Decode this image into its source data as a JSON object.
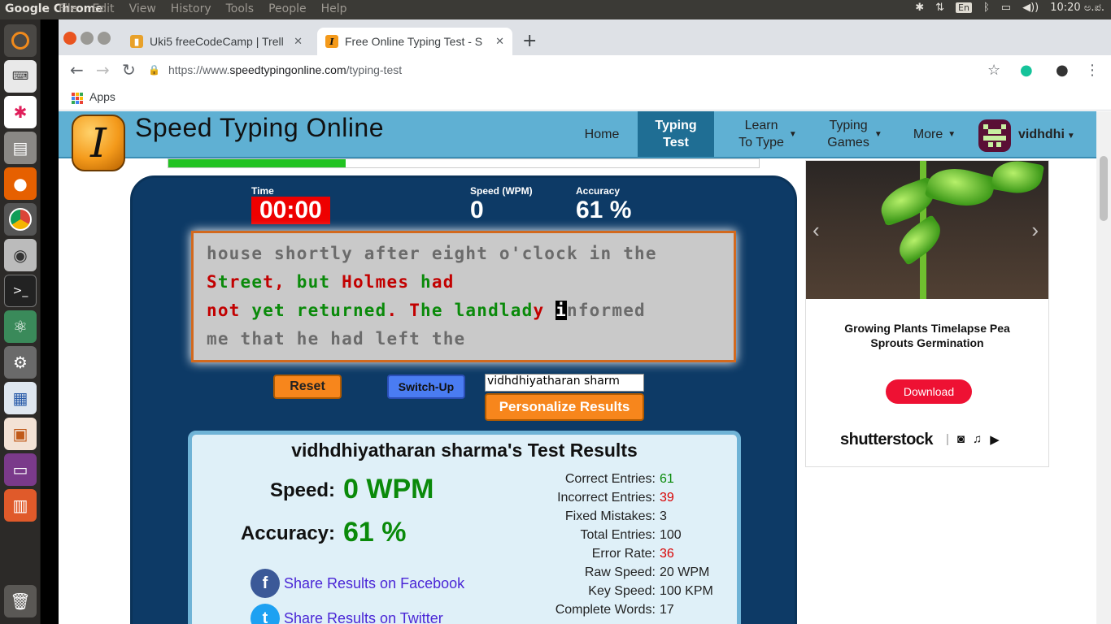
{
  "os": {
    "app_name": "Google Chrome",
    "menus": [
      "File",
      "Edit",
      "View",
      "History",
      "Tools",
      "People",
      "Help"
    ],
    "lang": "En",
    "clock": "10:20 ಅ.ಪ."
  },
  "browser": {
    "tabs": [
      {
        "title": "Uki5 freeCodeCamp | Trell",
        "favicon": "trello-icon"
      },
      {
        "title": "Free Online Typing Test - S",
        "favicon": "speedtyping-icon"
      }
    ],
    "url_scheme": "https://www.",
    "url_host": "speedtypingonline.com",
    "url_path": "/typing-test",
    "bookmark_apps": "Apps"
  },
  "site": {
    "title": "Speed Typing Online",
    "nav": [
      {
        "label1": "Home",
        "label2": ""
      },
      {
        "label1": "Typing",
        "label2": "Test"
      },
      {
        "label1": "Learn",
        "label2": "To Type"
      },
      {
        "label1": "Typing",
        "label2": "Games"
      },
      {
        "label1": "More",
        "label2": ""
      }
    ],
    "user_name": "vidhdhi",
    "progress": 0.3
  },
  "test": {
    "time_label": "Time",
    "time_value": "00:00",
    "speed_label": "Speed (WPM)",
    "speed_value": "0",
    "accuracy_label": "Accuracy",
    "accuracy_value": "61 %",
    "reset_label": "Reset",
    "switch_label": "Switch-Up",
    "name_input_value": "vidhdhiyatharan sharm",
    "personalize_label": "Personalize Results"
  },
  "results": {
    "title": "vidhdhiyatharan sharma's Test Results",
    "speed_label": "Speed:",
    "speed_value": "0 WPM",
    "accuracy_label": "Accuracy:",
    "accuracy_value": "61 %",
    "share_facebook": "Share Results on Facebook",
    "share_twitter": "Share Results on Twitter",
    "stats": [
      {
        "key": "Correct Entries:",
        "value": "61",
        "tone": "green"
      },
      {
        "key": "Incorrect Entries:",
        "value": "39",
        "tone": "red"
      },
      {
        "key": "Fixed Mistakes:",
        "value": "3",
        "tone": ""
      },
      {
        "key": "Total Entries:",
        "value": "100",
        "tone": ""
      },
      {
        "key": "Error Rate:",
        "value": "36",
        "tone": "red"
      },
      {
        "key": "Raw Speed:",
        "value": "20 WPM",
        "tone": ""
      },
      {
        "key": "Key Speed:",
        "value": "100 KPM",
        "tone": ""
      },
      {
        "key": "Complete Words:",
        "value": "17",
        "tone": ""
      }
    ]
  },
  "ad": {
    "title": "Growing Plants Timelapse Pea Sprouts Germination",
    "download": "Download",
    "brand": "shutterstock"
  }
}
